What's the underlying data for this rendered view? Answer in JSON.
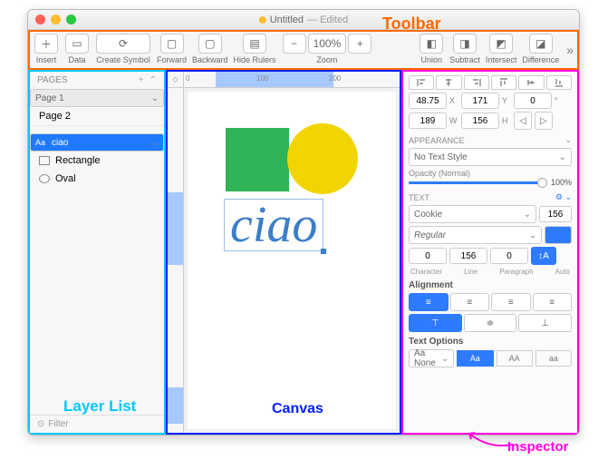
{
  "window": {
    "title": "Untitled",
    "edited": "— Edited"
  },
  "annotations": {
    "toolbar": "Toolbar",
    "layerlist": "Layer List",
    "canvas": "Canvas",
    "inspector": "Inspector"
  },
  "toolbar": {
    "insert": "Insert",
    "data": "Data",
    "create_symbol": "Create Symbol",
    "forward": "Forward",
    "backward": "Backward",
    "hide_rulers": "Hide Rulers",
    "zoom": "Zoom",
    "zoom_value": "100%",
    "union": "Union",
    "subtract": "Subtract",
    "intersect": "Intersect",
    "difference": "Difference"
  },
  "sidebar": {
    "pages_label": "PAGES",
    "pages": [
      "Page 1",
      "Page 2"
    ],
    "layers": [
      {
        "icon": "text",
        "label": "ciao",
        "prefix": "Aa",
        "selected": true
      },
      {
        "icon": "rect",
        "label": "Rectangle",
        "selected": false
      },
      {
        "icon": "oval",
        "label": "Oval",
        "selected": false
      }
    ],
    "filter_placeholder": "Filter"
  },
  "canvas": {
    "ruler_marks": [
      "0",
      "100",
      "200"
    ],
    "text_layer": "ciao"
  },
  "inspector": {
    "x": "48.75",
    "y": "171",
    "rot": "0",
    "w": "189",
    "h": "156",
    "appearance_label": "APPEARANCE",
    "text_style": "No Text Style",
    "opacity_label": "Opacity (Normal)",
    "opacity_value": "100%",
    "text_label": "TEXT",
    "font": "Cookie",
    "font_size": "156",
    "weight": "Regular",
    "char": "0",
    "line": "156",
    "para": "0",
    "char_l": "Character",
    "line_l": "Line",
    "para_l": "Paragraph",
    "auto_l": "Auto",
    "align_label": "Alignment",
    "textopt_label": "Text Options",
    "transform": "Aa None",
    "caps": [
      "Aa",
      "AA",
      "aa"
    ]
  }
}
